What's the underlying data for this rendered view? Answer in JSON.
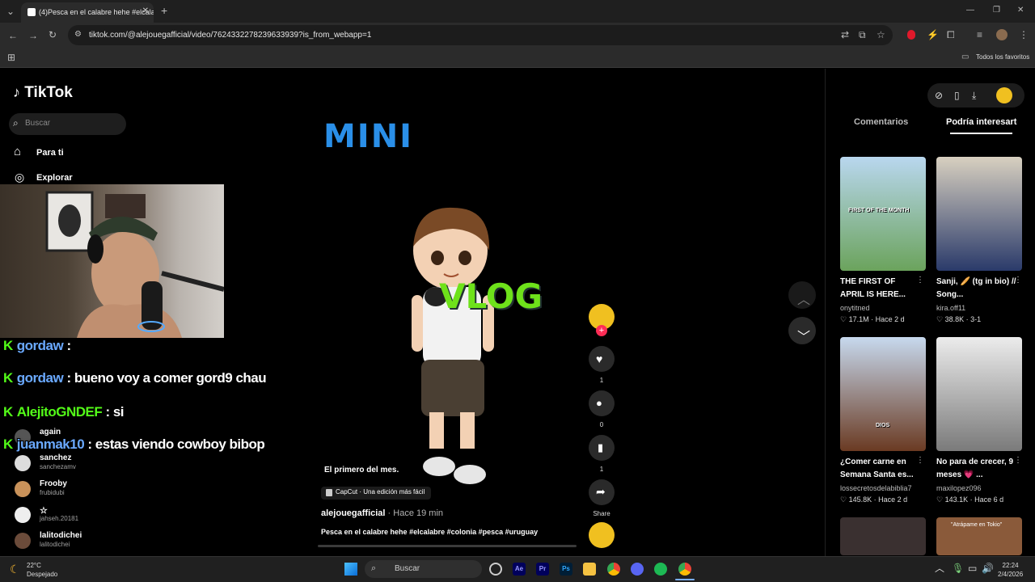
{
  "browser": {
    "tab_title": "(4)Pesca en el calabre hehe #elcala",
    "url": "tiktok.com/@alejouegafficial/video/7624332278239633939?is_from_webapp=1",
    "bookmarks_label": "Todos los favoritos"
  },
  "sidebar": {
    "logo": "TikTok",
    "search_placeholder": "Buscar",
    "nav": [
      {
        "label": "Para ti",
        "icon": "home-icon"
      },
      {
        "label": "Explorar",
        "icon": "compass-icon"
      }
    ],
    "accounts": [
      {
        "name": "again",
        "handle": ""
      },
      {
        "name": "sanchez",
        "handle": "sanchezamv"
      },
      {
        "name": "Frooby",
        "handle": "frubidubi"
      },
      {
        "name": "",
        "handle": "jahseh.20181"
      },
      {
        "name": "lalitodichei",
        "handle": "lalitodichei"
      }
    ]
  },
  "stream_chat": [
    {
      "user": "gordaw",
      "message": ":",
      "user_color": "#6aa9ff"
    },
    {
      "user": "gordaw",
      "message": ": bueno voy a comer gord9 chau",
      "user_color": "#6aa9ff"
    },
    {
      "user": "AlejitoGNDEF",
      "message": ": si",
      "user_color": "#53fc18"
    },
    {
      "user": "juanmak10",
      "message": ": estas viendo cowboy bibop",
      "user_color": "#6aa9ff"
    }
  ],
  "video": {
    "overlay_top": "MINI",
    "overlay_mid": "VLOG",
    "caption": "El primero del mes.",
    "capcut_label": "CapCut · Una edición más fácil",
    "author": "alejouegafficial",
    "time": " · Hace 19 min",
    "description": "Pesca en el calabre hehe #elcalabre #colonia #pesca #uruguay",
    "likes": "1",
    "comments": "0",
    "saves": "1",
    "share_label": "Share"
  },
  "right_panel": {
    "tabs": [
      "Comentarios",
      "Podría interesarte"
    ],
    "videos": [
      {
        "title": "THE FIRST OF APRIL IS HERE...",
        "thumb_text": "FIRST OF THE MONTH",
        "user": "onytitned",
        "likes": "17.1M",
        "age": "Hace 2 d"
      },
      {
        "title": "Sanji, 🥖 (tg in bio) // Song...",
        "thumb_text": "",
        "user": "kira.off11",
        "likes": "38.8K",
        "age": "3-1"
      },
      {
        "title": "¿Comer carne en Semana Santa es...",
        "thumb_text": "DIOS",
        "user": "lossecretosdelabiblia7",
        "likes": "145.8K",
        "age": "Hace 2 d"
      },
      {
        "title": "No para de crecer, 9 meses 💗 ...",
        "thumb_text": "",
        "user": "maxilopez096",
        "likes": "143.1K",
        "age": "Hace 6 d"
      },
      {
        "title": "",
        "thumb_text": "",
        "user": "",
        "likes": "",
        "age": ""
      },
      {
        "title": "",
        "thumb_text": "\"Atrápame en Tokio\"",
        "user": "",
        "likes": "",
        "age": ""
      }
    ]
  },
  "taskbar": {
    "temp": "22°C",
    "condition": "Despejado",
    "search": "Buscar",
    "time": "22:24",
    "date": "2/4/2026"
  }
}
